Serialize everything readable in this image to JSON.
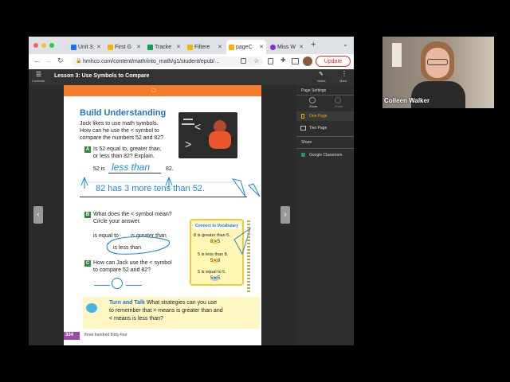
{
  "browser": {
    "tabs": [
      {
        "label": "Unit 3:",
        "color": "#1a73e8"
      },
      {
        "label": "First G",
        "color": "#f4b400"
      },
      {
        "label": "Tracke",
        "color": "#0f9d58"
      },
      {
        "label": "Filtere",
        "color": "#f4b400"
      },
      {
        "label": "pageC",
        "color": "#f4b400"
      },
      {
        "label": "Miss W",
        "color": "#8430ce"
      }
    ],
    "url": "hmhco.com/content/math/into_math/g1/student/epub/...",
    "update_label": "Update"
  },
  "app": {
    "contents_label": "Contents",
    "lesson_title": "Lesson 3: Use Symbols to Compare",
    "notes_label": "Notes",
    "more_label": "More"
  },
  "side_panel": {
    "page_settings": "Page Settings",
    "zoom_out": "Zoom",
    "zoom_in": "Zoom",
    "one_page": "One Page",
    "two_page": "Two Page",
    "share": "Share",
    "google_classroom": "Google Classroom"
  },
  "page": {
    "heading": "Build Understanding",
    "intro": [
      "Jock likes to use math symbols.",
      "How can he use the < symbol to",
      "compare the numbers 52 and 82?"
    ],
    "qa_letter": "A",
    "qa_text": [
      "Is 52 equal to, greater than,",
      "or less than 82? Explain."
    ],
    "qa_left": "52 is",
    "qa_answer": "less than",
    "qa_right": "82.",
    "qa_handwriting": "82 has 3 more tens than 52.",
    "qb_letter": "B",
    "qb_text": [
      "What does the < symbol mean?",
      "Circle your answer."
    ],
    "qb_option1": "is equal to",
    "qb_option2": "is greater than",
    "qb_option3": "is less than",
    "qc_letter": "C",
    "qc_text": [
      "How can Jack use the < symbol",
      "to compare 52 and 82?"
    ],
    "vocab_title": "Connect to Vocabulary",
    "vocab_1": "8 is greater than 5.",
    "vocab_1_expr": [
      "8",
      ">",
      "5"
    ],
    "vocab_2": "5 is less than 8.",
    "vocab_2_expr": [
      "5",
      "<",
      "8"
    ],
    "vocab_3": "5 is equal to 5.",
    "vocab_3_expr": [
      "5",
      "=",
      "5"
    ],
    "turn_talk_title": "Turn and Talk",
    "turn_talk_line1": "What strategies can you use",
    "turn_talk_line2": "to remember that > means is greater than and",
    "turn_talk_line3": "< means is less than?",
    "page_number": "334",
    "page_words": "three hundred thirty-four"
  },
  "video": {
    "name": "Colleen Walker"
  },
  "colors": {
    "accent_blue": "#1f77c9",
    "badge_green": "#2e8b3a",
    "page_orange": "#f47c2c",
    "update_red": "#d93025"
  }
}
